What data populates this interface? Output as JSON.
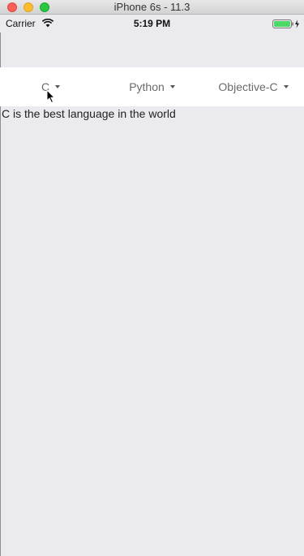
{
  "window": {
    "title": "iPhone 6s - 11.3"
  },
  "status_bar": {
    "carrier": "Carrier",
    "time": "5:19 PM",
    "signal_icon": "wifi-icon",
    "battery_icon": "battery-icon",
    "battery_color": "#4cd964"
  },
  "menu": {
    "items": [
      {
        "label": "C",
        "icon": "caret-down-icon"
      },
      {
        "label": "Python",
        "icon": "caret-down-icon"
      },
      {
        "label": "Objective-C",
        "icon": "caret-down-icon"
      }
    ]
  },
  "content": {
    "text": "C is the best language in the world"
  }
}
